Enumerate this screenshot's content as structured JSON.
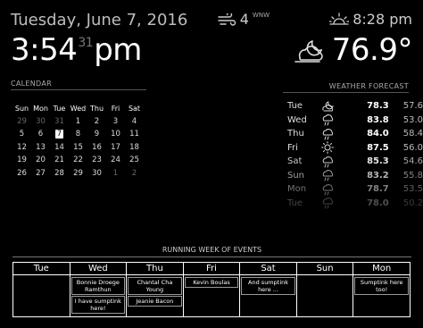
{
  "clock": {
    "date": "Tuesday, June 7, 2016",
    "hours_minutes": "3:54",
    "seconds": "31",
    "ampm": "pm"
  },
  "wind": {
    "speed": "4",
    "direction": "WNW",
    "icon": "wind-icon"
  },
  "sunset": {
    "time": "8:28 pm",
    "icon": "sunset-icon"
  },
  "current_weather": {
    "temperature": "76.9°",
    "icon": "cloudy-night-icon"
  },
  "calendar": {
    "header": "CALENDAR",
    "weekdays": [
      "Sun",
      "Mon",
      "Tue",
      "Wed",
      "Thu",
      "Fri",
      "Sat"
    ],
    "weeks": [
      [
        "29",
        "30",
        "31",
        "1",
        "2",
        "3",
        "4"
      ],
      [
        "5",
        "6",
        "7",
        "8",
        "9",
        "10",
        "11"
      ],
      [
        "12",
        "13",
        "14",
        "15",
        "16",
        "17",
        "18"
      ],
      [
        "19",
        "20",
        "21",
        "22",
        "23",
        "24",
        "25"
      ],
      [
        "26",
        "27",
        "28",
        "29",
        "30",
        "1",
        "2"
      ]
    ],
    "today": "7"
  },
  "forecast": {
    "header": "WEATHER FORECAST",
    "days": [
      {
        "day": "Tue",
        "icon": "cloudy-night-icon",
        "high": "78.3",
        "low": "57.6"
      },
      {
        "day": "Wed",
        "icon": "showers-icon",
        "high": "83.8",
        "low": "53.0"
      },
      {
        "day": "Thu",
        "icon": "showers-icon",
        "high": "84.0",
        "low": "58.4"
      },
      {
        "day": "Fri",
        "icon": "sunny-icon",
        "high": "87.5",
        "low": "56.0"
      },
      {
        "day": "Sat",
        "icon": "showers-icon",
        "high": "85.3",
        "low": "54.6"
      },
      {
        "day": "Sun",
        "icon": "showers-icon",
        "high": "83.2",
        "low": "55.8"
      },
      {
        "day": "Mon",
        "icon": "showers-icon",
        "high": "78.7",
        "low": "53.5"
      },
      {
        "day": "Tue",
        "icon": "showers-icon",
        "high": "78.0",
        "low": "50.2"
      }
    ]
  },
  "events": {
    "header": "RUNNING WEEK OF EVENTS",
    "days": [
      {
        "name": "Tue",
        "items": []
      },
      {
        "name": "Wed",
        "items": [
          "Bonnie Droege Ramthun",
          "I have sumptink here!"
        ]
      },
      {
        "name": "Thu",
        "items": [
          "Chantal Cha Young",
          "Jeanie Bacon"
        ]
      },
      {
        "name": "Fri",
        "items": [
          "Kevin Boulas"
        ]
      },
      {
        "name": "Sat",
        "items": [
          "And sumptink here ..."
        ]
      },
      {
        "name": "Sun",
        "items": []
      },
      {
        "name": "Mon",
        "items": [
          "Sumptink here too!"
        ]
      }
    ]
  }
}
